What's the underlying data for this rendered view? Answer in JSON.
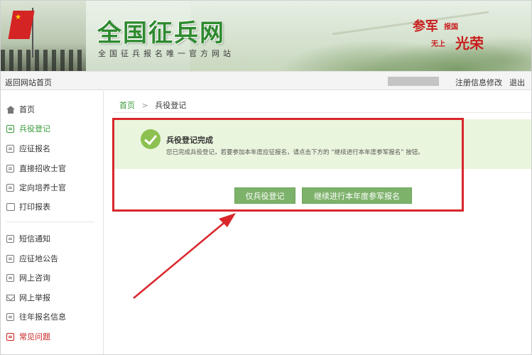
{
  "banner": {
    "site_title": "全国征兵网",
    "site_subtitle": "全国征兵报名唯一官方网站",
    "slogan": {
      "line1": "参军",
      "line2": "报国",
      "line3": "无上",
      "line4": "光荣"
    }
  },
  "topbar": {
    "home_link": "返回网站首页",
    "edit_info": "注册信息修改",
    "logout": "退出"
  },
  "sidebar": {
    "items": [
      {
        "label": "首页"
      },
      {
        "label": "兵役登记"
      },
      {
        "label": "应征报名"
      },
      {
        "label": "直接招收士官"
      },
      {
        "label": "定向培养士官"
      },
      {
        "label": "打印报表"
      },
      {
        "label": "短信通知"
      },
      {
        "label": "应征地公告"
      },
      {
        "label": "网上咨询"
      },
      {
        "label": "网上举报"
      },
      {
        "label": "往年报名信息"
      },
      {
        "label": "常见问题"
      }
    ]
  },
  "breadcrumb": {
    "home": "首页",
    "separator": ">",
    "current": "兵役登记"
  },
  "notice": {
    "title": "兵役登记完成",
    "description": "您已完成兵役登记，若要参加本年度应征报名，请点击下方的 “继续进行本年度参军报名” 按钮。"
  },
  "buttons": {
    "only_register": "仅兵役登记",
    "continue_enlist": "继续进行本年度参军报名"
  },
  "colors": {
    "accent_green": "#7db26b",
    "highlight_red": "#d9262b",
    "notice_bg": "#eaf5dd"
  }
}
